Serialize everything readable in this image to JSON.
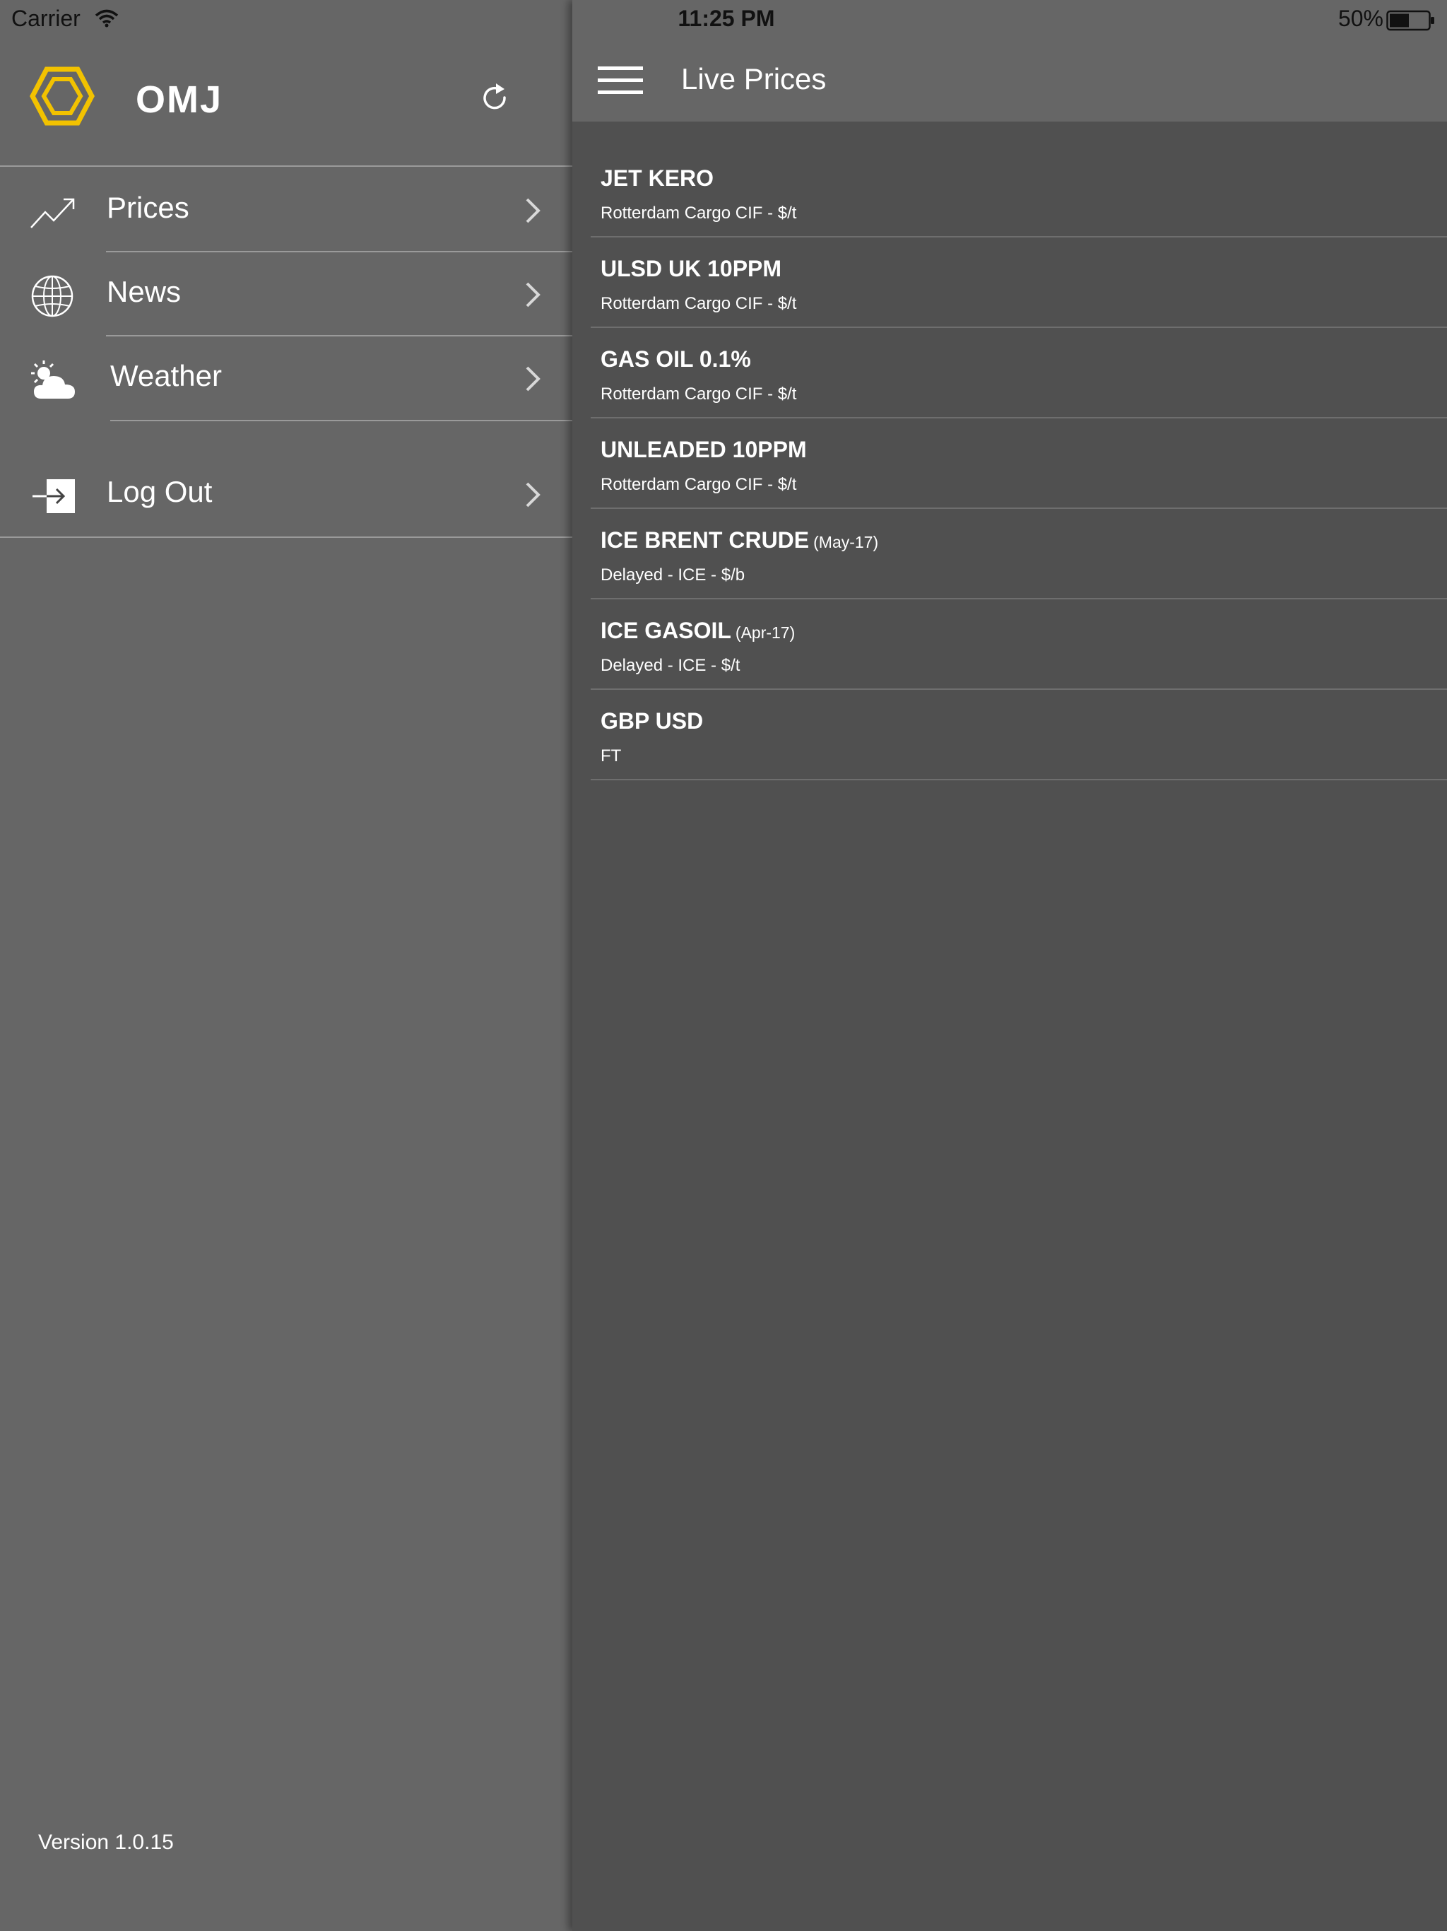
{
  "status_bar": {
    "carrier": "Carrier",
    "time": "11:25 PM",
    "battery": "50%",
    "icons": [
      "wifi-icon",
      "battery-icon"
    ]
  },
  "sidebar": {
    "brand": "OMJ",
    "logo_color": "#f2c200",
    "icons": [
      "logo-icon",
      "refresh-icon"
    ],
    "items": [
      {
        "label": "Prices",
        "icon": "trend-up-icon"
      },
      {
        "label": "News",
        "icon": "globe-icon"
      },
      {
        "label": "Weather",
        "icon": "partly-cloudy-icon"
      },
      {
        "label": "Log Out",
        "icon": "logout-icon"
      }
    ],
    "version": "Version 1.0.15"
  },
  "main": {
    "title": "Live Prices",
    "menu_icon": "hamburger-icon",
    "prices": [
      {
        "name": "JET KERO",
        "date": "",
        "source": "Rotterdam Cargo CIF - $/t"
      },
      {
        "name": "ULSD UK 10PPM",
        "date": "",
        "source": "Rotterdam Cargo CIF - $/t"
      },
      {
        "name": "GAS OIL 0.1%",
        "date": "",
        "source": "Rotterdam Cargo CIF - $/t"
      },
      {
        "name": "UNLEADED 10PPM",
        "date": "",
        "source": "Rotterdam Cargo CIF - $/t"
      },
      {
        "name": "ICE BRENT CRUDE",
        "date": "(May-17)",
        "source": "Delayed - ICE - $/b"
      },
      {
        "name": "ICE GASOIL",
        "date": "(Apr-17)",
        "source": "Delayed - ICE - $/t"
      },
      {
        "name": "GBP USD",
        "date": "",
        "source": "FT"
      }
    ]
  },
  "colors": {
    "sidebar_bg": "#666666",
    "main_bg": "#505050",
    "accent": "#f2c200",
    "text": "#ffffff"
  }
}
